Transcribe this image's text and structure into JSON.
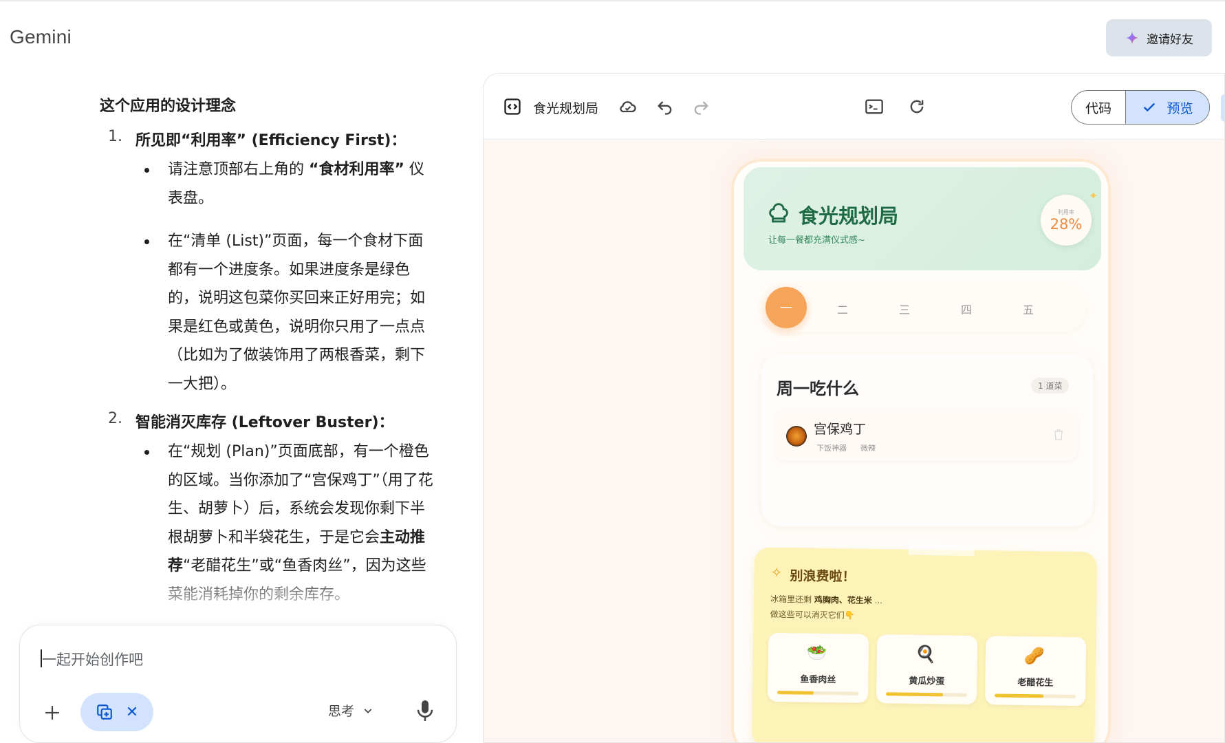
{
  "app": {
    "title": "Gemini",
    "invite_label": "邀请好友"
  },
  "chat": {
    "section_title": "这个应用的设计理念",
    "points": [
      {
        "num": "1.",
        "title": "所见即“利用率” (Efficiency First)："
      },
      {
        "num": "2.",
        "title": "智能消灭库存 (Leftover Buster)："
      }
    ],
    "bullets": {
      "b1_pre": "请注意顶部右上角的 ",
      "b1_bold": "“食材利用率”",
      "b1_post": " 仪表盘。",
      "b2": "在“清单 (List)”页面，每一个食材下面都有一个进度条。如果进度条是绿色的，说明这包菜你买回来正好用完；如果是红色或黄色，说明你只用了一点点（比如为了做装饰用了两根香菜，剩下一大把）。",
      "b3_pre": "在“规划 (Plan)”页面底部，有一个橙色的区域。当你添加了“宫保鸡丁”（用了花生、胡萝卜）后，系统会发现你剩下半根胡萝卜和半袋花生，于是它会",
      "b3_bold": "主动推荐",
      "b3_post": "“老醋花生”或“鱼香肉丝”，因为这些菜能消耗掉你的剩余库存。"
    },
    "input": {
      "placeholder": "一起开始创作吧",
      "think_label": "思考"
    }
  },
  "canvas": {
    "title": "食光规划局",
    "code_label": "代码",
    "preview_label": "预览"
  },
  "preview": {
    "title": "食光规划局",
    "subtitle": "让每一餐都充满仪式感~",
    "rate_label": "利用率",
    "rate_value": "28%",
    "days": [
      "一",
      "二",
      "三",
      "四",
      "五"
    ],
    "active_day": 0,
    "meal_title": "周一吃什么",
    "meal_count": "1 道菜",
    "dish": {
      "name": "宫保鸡丁",
      "tag1": "下饭神器",
      "tag2": "微辣"
    },
    "waste": {
      "title": "别浪费啦！",
      "line1_pre": "冰箱里还剩 ",
      "line1_items": "鸡胸肉、花生米",
      "line1_post": " ...",
      "line2": "做这些可以消灭它们👇",
      "recos": [
        {
          "name": "鱼香肉丝",
          "icon": "🥗",
          "progress": 0.45
        },
        {
          "name": "黄瓜炒蛋",
          "icon": "🍳",
          "progress": 0.7
        },
        {
          "name": "老醋花生",
          "icon": "🥜",
          "progress": 0.6
        }
      ]
    }
  },
  "colors": {
    "accent_blue": "#0b57d0",
    "hero_green": "#1e6b45",
    "day_active": "#f6a45a",
    "rate_orange": "#f08a3c",
    "waste_yellow": "#fdf2b8"
  },
  "icons": [
    "sparkle-icon",
    "plus-icon",
    "copy-icon",
    "close-icon",
    "chevron-down-icon",
    "mic-icon",
    "code-view-icon",
    "cloud-icon",
    "undo-icon",
    "redo-icon",
    "terminal-icon",
    "refresh-icon",
    "check-icon",
    "chef-hat-icon",
    "trash-icon"
  ]
}
